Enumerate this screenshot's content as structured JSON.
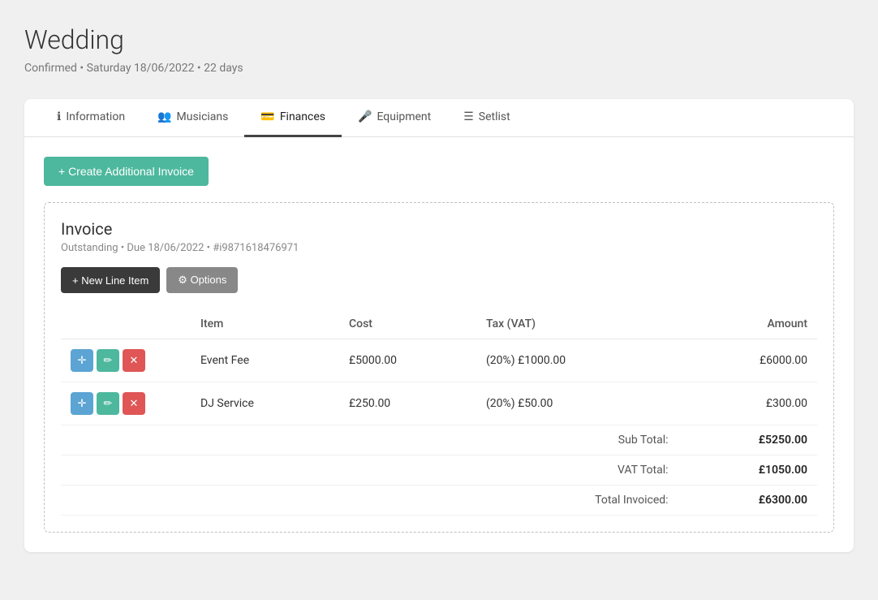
{
  "page": {
    "title": "Wedding",
    "subtitle": "Confirmed • Saturday 18/06/2022 • 22 days"
  },
  "tabs": [
    {
      "id": "information",
      "label": "Information",
      "icon": "ℹ",
      "active": false
    },
    {
      "id": "musicians",
      "label": "Musicians",
      "icon": "👥",
      "active": false
    },
    {
      "id": "finances",
      "label": "Finances",
      "icon": "💳",
      "active": true
    },
    {
      "id": "equipment",
      "label": "Equipment",
      "icon": "🎤",
      "active": false
    },
    {
      "id": "setlist",
      "label": "Setlist",
      "icon": "☰",
      "active": false
    }
  ],
  "create_button": "+ Create Additional Invoice",
  "invoice": {
    "title": "Invoice",
    "meta": "Outstanding • Due 18/06/2022 • #i9871618476971",
    "new_line_item_label": "+ New Line Item",
    "options_label": "⚙ Options",
    "table": {
      "headers": [
        "Item",
        "Cost",
        "Tax (VAT)",
        "Amount"
      ],
      "rows": [
        {
          "item": "Event Fee",
          "cost": "£5000.00",
          "tax": "(20%) £1000.00",
          "amount": "£6000.00"
        },
        {
          "item": "DJ Service",
          "cost": "£250.00",
          "tax": "(20%) £50.00",
          "amount": "£300.00"
        }
      ],
      "sub_total_label": "Sub Total:",
      "sub_total_value": "£5250.00",
      "vat_total_label": "VAT Total:",
      "vat_total_value": "£1050.00",
      "total_invoiced_label": "Total Invoiced:",
      "total_invoiced_value": "£6300.00"
    }
  },
  "colors": {
    "accent_teal": "#4db89e",
    "btn_dark": "#3a3a3a",
    "move_blue": "#5ba4d4",
    "delete_red": "#e05555"
  }
}
